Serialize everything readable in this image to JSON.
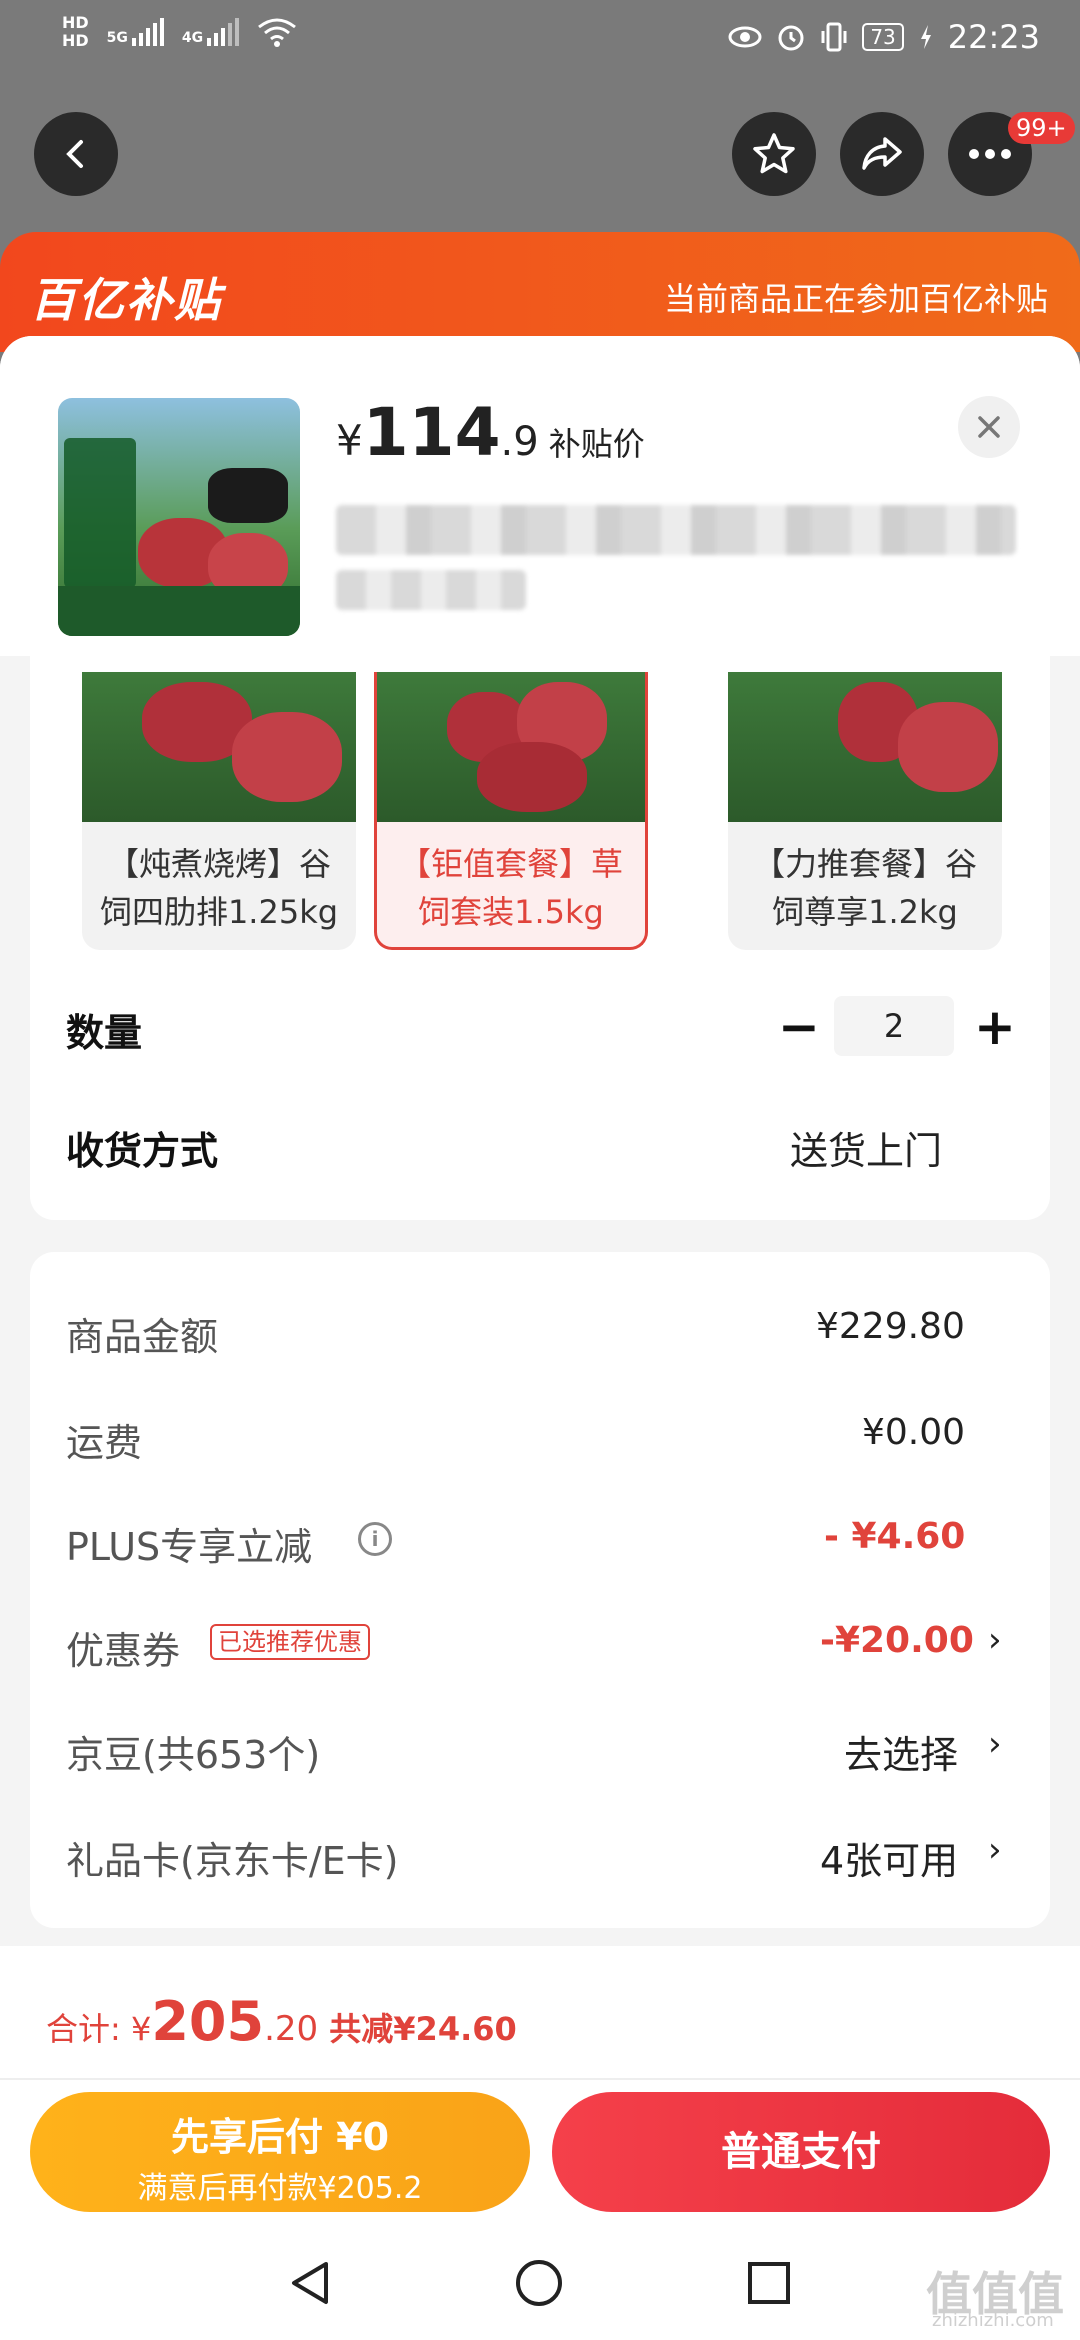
{
  "status_bar": {
    "hd1": "HD",
    "hd2": "HD",
    "net1": "5G",
    "net2": "4G",
    "battery": "73",
    "time": "22:23"
  },
  "top_bar": {
    "badge": "99+"
  },
  "banner": {
    "logo": "百亿补贴",
    "text": "当前商品正在参加百亿补贴"
  },
  "product": {
    "price_symbol": "¥",
    "price_int": "114",
    "price_dec": ".9",
    "price_label": "补贴价"
  },
  "variants": [
    {
      "name_line1": "【炖煮烧烤】谷",
      "name_line2": "饲四肋排1.25kg",
      "selected": false
    },
    {
      "name_line1": "【钜值套餐】草",
      "name_line2": "饲套装1.5kg",
      "selected": true
    },
    {
      "name_line1": "【力推套餐】谷",
      "name_line2": "饲尊享1.2kg",
      "selected": false
    }
  ],
  "quantity": {
    "label": "数量",
    "minus": "−",
    "value": "2",
    "plus": "+"
  },
  "delivery": {
    "label": "收货方式",
    "value": "送货上门"
  },
  "costs": {
    "goods_label": "商品金额",
    "goods_value": "¥229.80",
    "shipping_label": "运费",
    "shipping_value": "¥0.00",
    "plus_label": "PLUS专享立减",
    "plus_value": "- ¥4.60",
    "coupon_label": "优惠券",
    "coupon_tag": "已选推荐优惠",
    "coupon_value": "-¥20.00",
    "jd_bean_label": "京豆(共653个)",
    "jd_bean_value": "去选择",
    "gift_card_label": "礼品卡(京东卡/E卡)",
    "gift_card_value": "4张可用"
  },
  "total": {
    "prefix": "合计: ¥",
    "int": "205",
    "dec": ".20",
    "discount": " 共减¥24.60"
  },
  "buttons": {
    "later_line1": "先享后付 ¥0",
    "later_line2": "满意后再付款¥205.2",
    "pay": "普通支付"
  },
  "watermark": {
    "main": "值值值",
    "sub": "zhizhizhi.com"
  },
  "colors": {
    "accent_red": "#e0433b",
    "banner_orange": "#f2471d",
    "later_yellow": "#ffb21a",
    "pay_red": "#e42c3a"
  }
}
